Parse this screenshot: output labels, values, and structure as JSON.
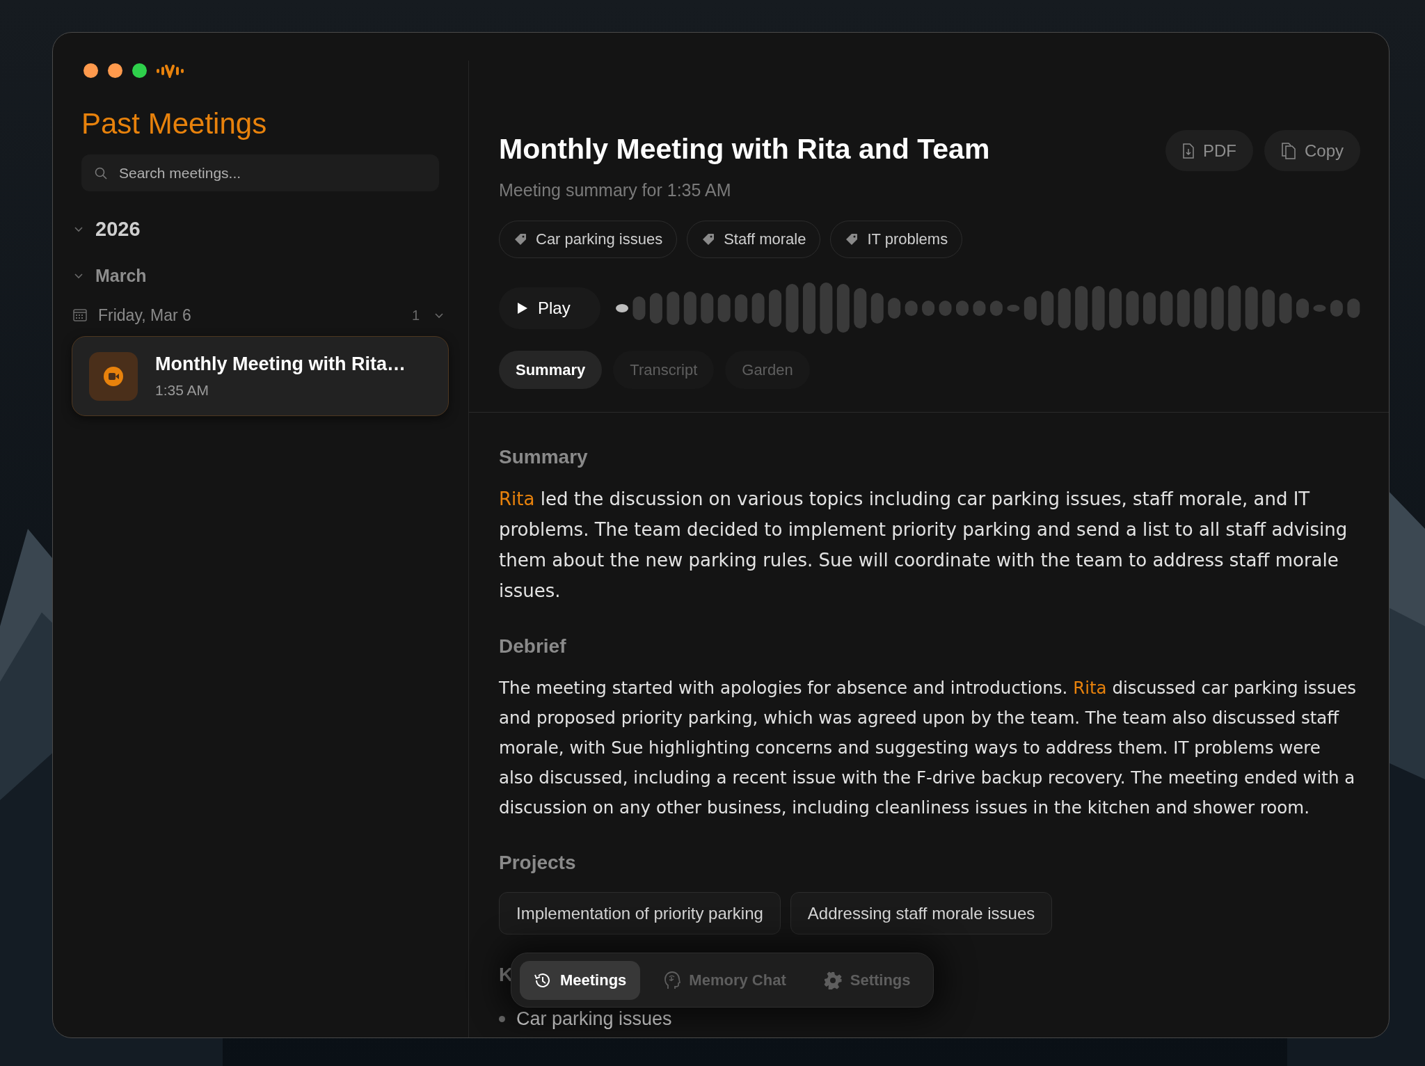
{
  "sidebar": {
    "title": "Past Meetings",
    "search": {
      "placeholder": "Search meetings..."
    },
    "tree": [
      {
        "label": "2026",
        "expanded": true,
        "children": [
          {
            "label": "March",
            "expanded": true,
            "children": [
              {
                "label": "Friday, Mar 6",
                "count": "1",
                "expanded": true,
                "children": [
                  {
                    "title": "Monthly Meeting with Rita…",
                    "time": "1:35 AM",
                    "selected": true
                  }
                ]
              }
            ]
          }
        ]
      }
    ]
  },
  "meeting": {
    "title": "Monthly Meeting with Rita and Team",
    "subtitle": "Meeting summary for 1:35 AM",
    "actions": [
      {
        "label": "PDF",
        "kind": "pdf"
      },
      {
        "label": "Copy",
        "kind": "copy"
      }
    ],
    "tags": [
      "Car parking issues",
      "Staff morale",
      "IT problems"
    ],
    "player": {
      "label": "Play"
    },
    "tabs": [
      {
        "label": "Summary",
        "selected": true
      },
      {
        "label": "Transcript",
        "selected": false
      },
      {
        "label": "Garden",
        "selected": false
      }
    ],
    "sections": [
      {
        "heading": "Summary",
        "kind": "paragraph",
        "text": "**Rita** led the discussion on various topics including car parking issues, staff morale, and IT problems. The team decided to implement priority parking and send a list to all staff advising them about the new parking rules. Sue will coordinate with the team to address staff morale issues."
      },
      {
        "heading": "Debrief",
        "kind": "paragraph",
        "text": "The meeting started with apologies for absence and introductions. **Rita** discussed car parking issues and proposed priority parking, which was agreed upon by the team. The team also discussed staff morale, with Sue highlighting concerns and suggesting ways to address them. IT problems were also discussed, including a recent issue with the F-drive backup recovery. The meeting ended with a discussion on any other business, including cleanliness issues in the kitchen and shower room."
      },
      {
        "heading": "Projects",
        "kind": "chips",
        "items": [
          "Implementation of priority parking",
          "Addressing staff morale issues"
        ]
      },
      {
        "heading": "K",
        "kind": "bullets",
        "items": [
          "Car parking issues"
        ]
      }
    ]
  },
  "nav": [
    {
      "label": "Meetings",
      "kind": "clock",
      "selected": true
    },
    {
      "label": "Memory Chat",
      "kind": "brain",
      "selected": false
    },
    {
      "label": "Settings",
      "kind": "gear",
      "selected": false
    }
  ]
}
